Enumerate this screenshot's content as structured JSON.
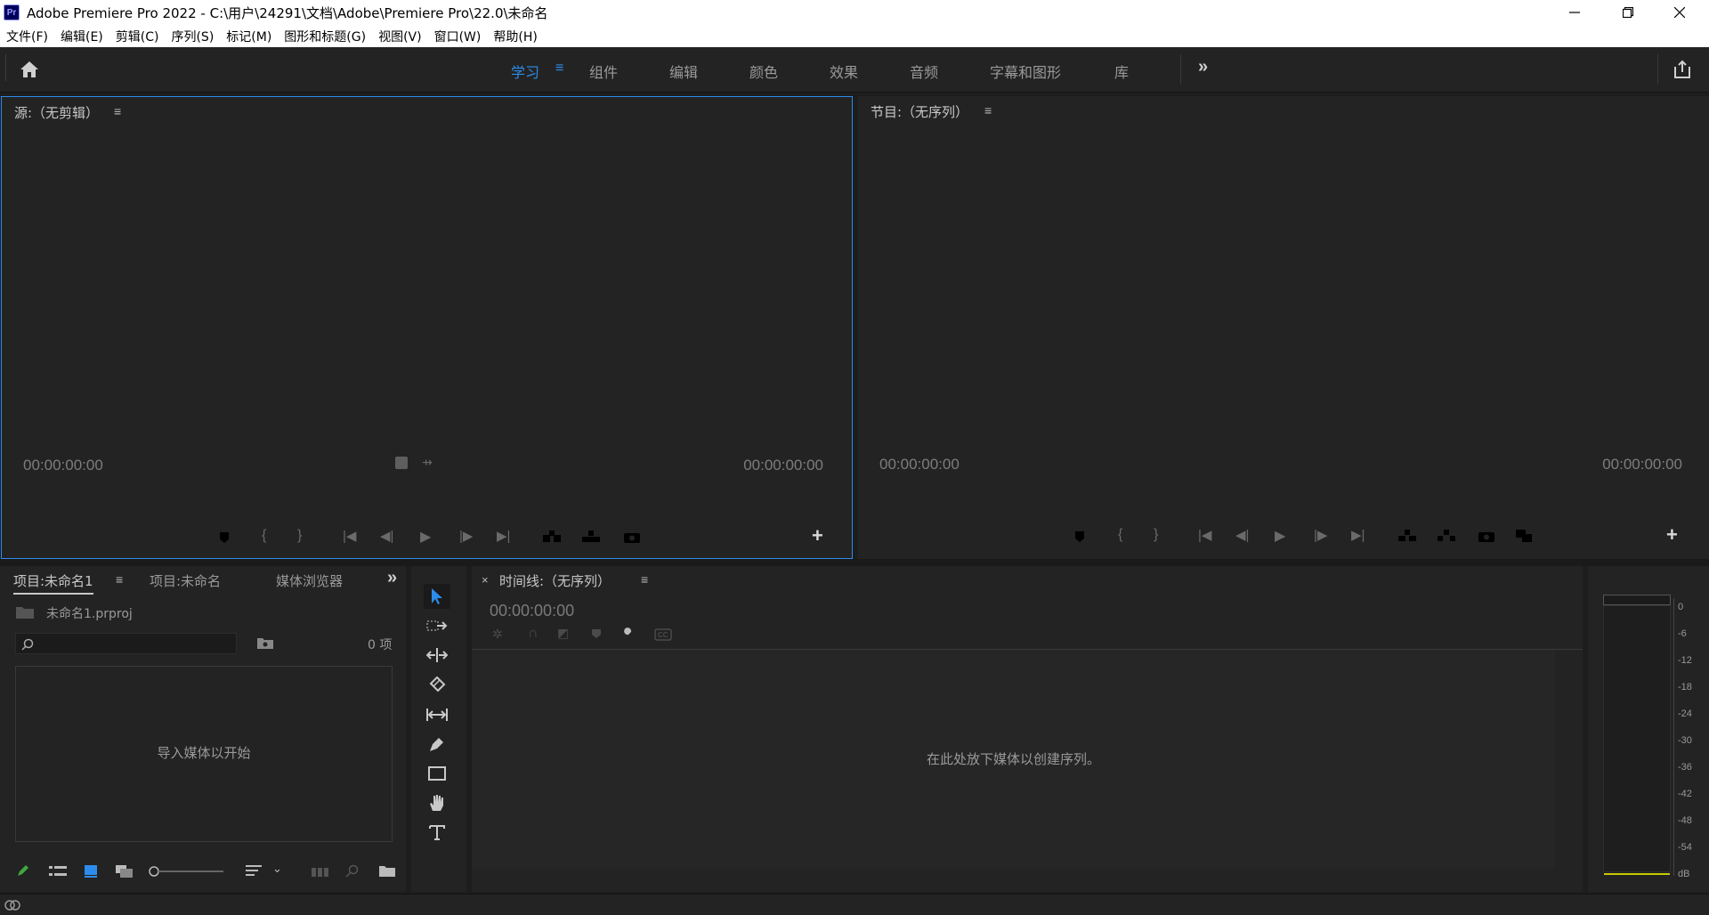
{
  "window": {
    "app_icon_label": "Pr",
    "title": "Adobe Premiere Pro 2022 - C:\\用户\\24291\\文档\\Adobe\\Premiere Pro\\22.0\\未命名"
  },
  "menu": [
    "文件(F)",
    "编辑(E)",
    "剪辑(C)",
    "序列(S)",
    "标记(M)",
    "图形和标题(G)",
    "视图(V)",
    "窗口(W)",
    "帮助(H)"
  ],
  "workspaces": {
    "tabs": [
      "学习",
      "组件",
      "编辑",
      "颜色",
      "效果",
      "音频",
      "字幕和图形",
      "库"
    ],
    "active": "学习"
  },
  "source_monitor": {
    "title": "源:（无剪辑）",
    "timecode_left": "00:00:00:00",
    "timecode_right": "00:00:00:00"
  },
  "program_monitor": {
    "title": "节目:（无序列）",
    "timecode_left": "00:00:00:00",
    "timecode_right": "00:00:00:00"
  },
  "project_panel": {
    "tabs": [
      "项目:未命名1",
      "项目:未命名",
      "媒体浏览器"
    ],
    "file_name": "未命名1.prproj",
    "item_count": "0 项",
    "search_placeholder": "",
    "empty_message": "导入媒体以开始"
  },
  "timeline": {
    "title": "时间线:（无序列）",
    "close": "×",
    "timecode": "00:00:00:00",
    "empty_message": "在此处放下媒体以创建序列。"
  },
  "audio_meter": {
    "scale": [
      "0",
      "-6",
      "-12",
      "-18",
      "-24",
      "-30",
      "-36",
      "-42",
      "-48",
      "-54",
      "dB"
    ],
    "level_color": "#c8c800"
  },
  "colors": {
    "accent": "#2d8ceb",
    "panel_bg": "#232323",
    "app_bg": "#1d1d1d"
  }
}
